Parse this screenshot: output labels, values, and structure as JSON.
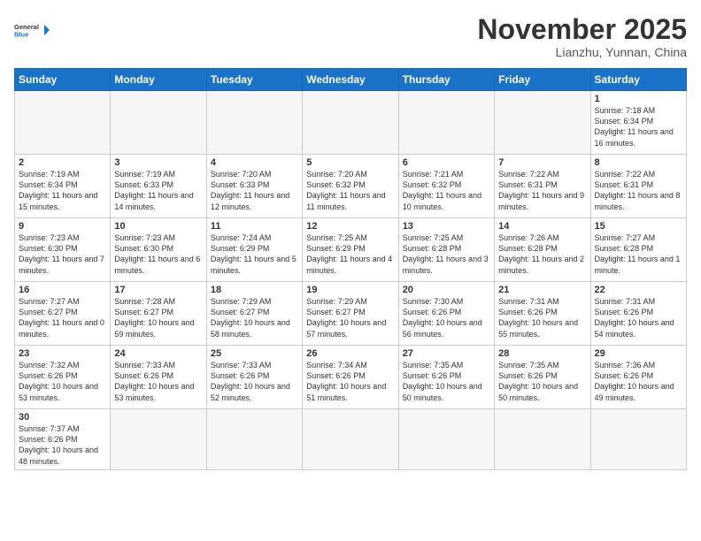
{
  "logo": {
    "general": "General",
    "blue": "Blue"
  },
  "header": {
    "month": "November 2025",
    "location": "Lianzhu, Yunnan, China"
  },
  "weekdays": [
    "Sunday",
    "Monday",
    "Tuesday",
    "Wednesday",
    "Thursday",
    "Friday",
    "Saturday"
  ],
  "days": [
    {
      "date": "1",
      "sunrise": "Sunrise: 7:18 AM",
      "sunset": "Sunset: 6:34 PM",
      "daylight": "Daylight: 11 hours and 16 minutes."
    },
    {
      "date": "2",
      "sunrise": "Sunrise: 7:19 AM",
      "sunset": "Sunset: 6:34 PM",
      "daylight": "Daylight: 11 hours and 15 minutes."
    },
    {
      "date": "3",
      "sunrise": "Sunrise: 7:19 AM",
      "sunset": "Sunset: 6:33 PM",
      "daylight": "Daylight: 11 hours and 14 minutes."
    },
    {
      "date": "4",
      "sunrise": "Sunrise: 7:20 AM",
      "sunset": "Sunset: 6:33 PM",
      "daylight": "Daylight: 11 hours and 12 minutes."
    },
    {
      "date": "5",
      "sunrise": "Sunrise: 7:20 AM",
      "sunset": "Sunset: 6:32 PM",
      "daylight": "Daylight: 11 hours and 11 minutes."
    },
    {
      "date": "6",
      "sunrise": "Sunrise: 7:21 AM",
      "sunset": "Sunset: 6:32 PM",
      "daylight": "Daylight: 11 hours and 10 minutes."
    },
    {
      "date": "7",
      "sunrise": "Sunrise: 7:22 AM",
      "sunset": "Sunset: 6:31 PM",
      "daylight": "Daylight: 11 hours and 9 minutes."
    },
    {
      "date": "8",
      "sunrise": "Sunrise: 7:22 AM",
      "sunset": "Sunset: 6:31 PM",
      "daylight": "Daylight: 11 hours and 8 minutes."
    },
    {
      "date": "9",
      "sunrise": "Sunrise: 7:23 AM",
      "sunset": "Sunset: 6:30 PM",
      "daylight": "Daylight: 11 hours and 7 minutes."
    },
    {
      "date": "10",
      "sunrise": "Sunrise: 7:23 AM",
      "sunset": "Sunset: 6:30 PM",
      "daylight": "Daylight: 11 hours and 6 minutes."
    },
    {
      "date": "11",
      "sunrise": "Sunrise: 7:24 AM",
      "sunset": "Sunset: 6:29 PM",
      "daylight": "Daylight: 11 hours and 5 minutes."
    },
    {
      "date": "12",
      "sunrise": "Sunrise: 7:25 AM",
      "sunset": "Sunset: 6:29 PM",
      "daylight": "Daylight: 11 hours and 4 minutes."
    },
    {
      "date": "13",
      "sunrise": "Sunrise: 7:25 AM",
      "sunset": "Sunset: 6:28 PM",
      "daylight": "Daylight: 11 hours and 3 minutes."
    },
    {
      "date": "14",
      "sunrise": "Sunrise: 7:26 AM",
      "sunset": "Sunset: 6:28 PM",
      "daylight": "Daylight: 11 hours and 2 minutes."
    },
    {
      "date": "15",
      "sunrise": "Sunrise: 7:27 AM",
      "sunset": "Sunset: 6:28 PM",
      "daylight": "Daylight: 11 hours and 1 minute."
    },
    {
      "date": "16",
      "sunrise": "Sunrise: 7:27 AM",
      "sunset": "Sunset: 6:27 PM",
      "daylight": "Daylight: 11 hours and 0 minutes."
    },
    {
      "date": "17",
      "sunrise": "Sunrise: 7:28 AM",
      "sunset": "Sunset: 6:27 PM",
      "daylight": "Daylight: 10 hours and 59 minutes."
    },
    {
      "date": "18",
      "sunrise": "Sunrise: 7:29 AM",
      "sunset": "Sunset: 6:27 PM",
      "daylight": "Daylight: 10 hours and 58 minutes."
    },
    {
      "date": "19",
      "sunrise": "Sunrise: 7:29 AM",
      "sunset": "Sunset: 6:27 PM",
      "daylight": "Daylight: 10 hours and 57 minutes."
    },
    {
      "date": "20",
      "sunrise": "Sunrise: 7:30 AM",
      "sunset": "Sunset: 6:26 PM",
      "daylight": "Daylight: 10 hours and 56 minutes."
    },
    {
      "date": "21",
      "sunrise": "Sunrise: 7:31 AM",
      "sunset": "Sunset: 6:26 PM",
      "daylight": "Daylight: 10 hours and 55 minutes."
    },
    {
      "date": "22",
      "sunrise": "Sunrise: 7:31 AM",
      "sunset": "Sunset: 6:26 PM",
      "daylight": "Daylight: 10 hours and 54 minutes."
    },
    {
      "date": "23",
      "sunrise": "Sunrise: 7:32 AM",
      "sunset": "Sunset: 6:26 PM",
      "daylight": "Daylight: 10 hours and 53 minutes."
    },
    {
      "date": "24",
      "sunrise": "Sunrise: 7:33 AM",
      "sunset": "Sunset: 6:26 PM",
      "daylight": "Daylight: 10 hours and 53 minutes."
    },
    {
      "date": "25",
      "sunrise": "Sunrise: 7:33 AM",
      "sunset": "Sunset: 6:26 PM",
      "daylight": "Daylight: 10 hours and 52 minutes."
    },
    {
      "date": "26",
      "sunrise": "Sunrise: 7:34 AM",
      "sunset": "Sunset: 6:26 PM",
      "daylight": "Daylight: 10 hours and 51 minutes."
    },
    {
      "date": "27",
      "sunrise": "Sunrise: 7:35 AM",
      "sunset": "Sunset: 6:26 PM",
      "daylight": "Daylight: 10 hours and 50 minutes."
    },
    {
      "date": "28",
      "sunrise": "Sunrise: 7:35 AM",
      "sunset": "Sunset: 6:26 PM",
      "daylight": "Daylight: 10 hours and 50 minutes."
    },
    {
      "date": "29",
      "sunrise": "Sunrise: 7:36 AM",
      "sunset": "Sunset: 6:26 PM",
      "daylight": "Daylight: 10 hours and 49 minutes."
    },
    {
      "date": "30",
      "sunrise": "Sunrise: 7:37 AM",
      "sunset": "Sunset: 6:26 PM",
      "daylight": "Daylight: 10 hours and 48 minutes."
    }
  ]
}
